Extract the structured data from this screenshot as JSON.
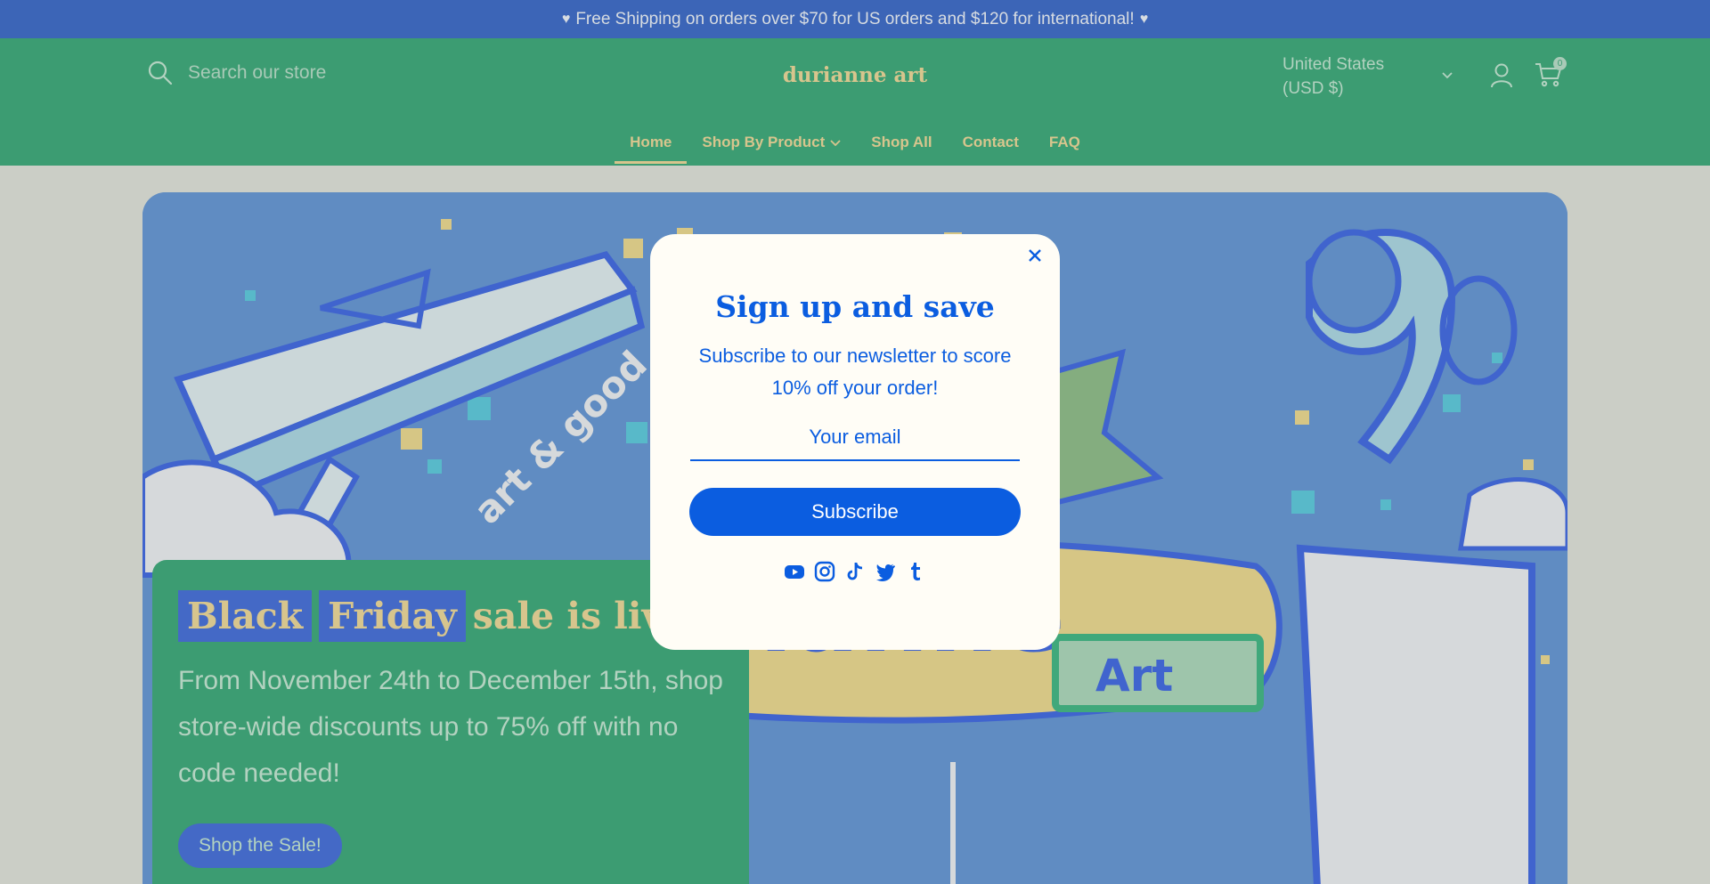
{
  "announcement": {
    "text": "Free Shipping on orders over $70 for US orders and $120 for international!",
    "icon": "heart-icon"
  },
  "header": {
    "search_placeholder": "Search our store",
    "logo": "durianne art",
    "currency_line1": "United States",
    "currency_line2": "(USD $)",
    "cart_count": "0"
  },
  "nav": {
    "items": [
      {
        "label": "Home",
        "active": true
      },
      {
        "label": "Shop By Product",
        "dropdown": true
      },
      {
        "label": "Shop All"
      },
      {
        "label": "Contact"
      },
      {
        "label": "FAQ"
      }
    ]
  },
  "hero": {
    "title_word1": "Black",
    "title_word2": "Friday",
    "title_rest": "sale is live",
    "text": "From November 24th to December 15th, shop store-wide discounts up to 75% off with no code needed!",
    "button": "Shop the Sale!"
  },
  "popup": {
    "title": "Sign up and save",
    "text": "Subscribe to our newsletter to score 10% off your order!",
    "email_placeholder": "Your email",
    "button": "Subscribe",
    "socials": [
      "youtube-icon",
      "instagram-icon",
      "tiktok-icon",
      "twitter-icon",
      "tumblr-icon"
    ]
  },
  "colors": {
    "announcement_bg": "#0a40b0",
    "header_bg": "#0a8a55",
    "gold": "#d8c079",
    "popup_blue": "#0b5de0"
  }
}
